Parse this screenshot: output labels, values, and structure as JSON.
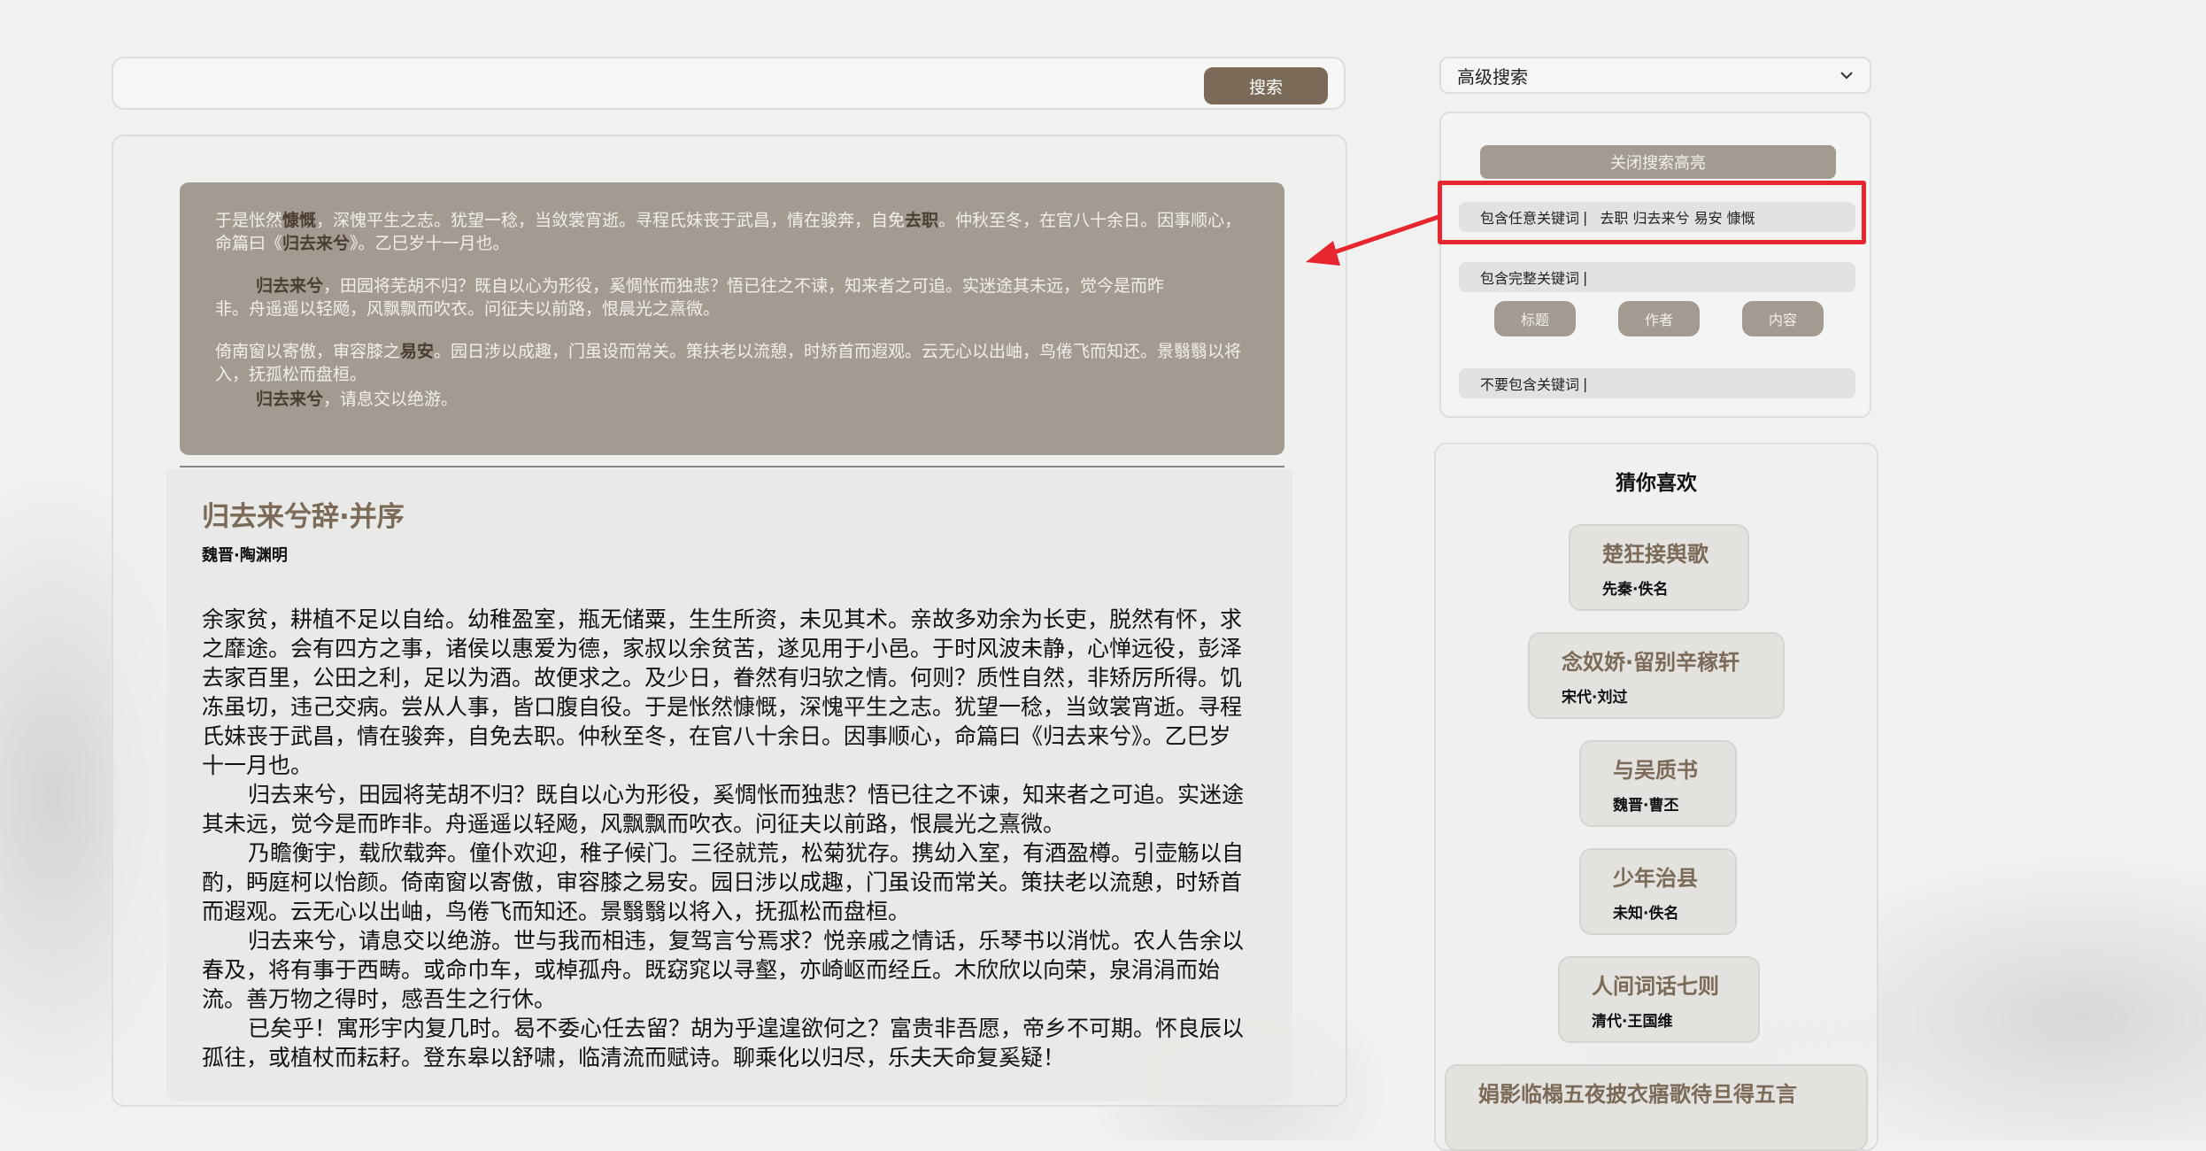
{
  "search": {
    "value": "",
    "button_label": "搜索"
  },
  "highlight": {
    "p1": {
      "a": "于是怅然",
      "k1": "慷慨",
      "b": "，深愧平生之志。犹望一稔，当敛裳宵逝。寻程氏妹丧于武昌，情在骏奔，自免",
      "k2": "去职",
      "c": "。仲秋至冬，在官八十余日。因事顺心，命篇曰《",
      "k3": "归去来兮",
      "d": "》。乙巳岁十一月也。"
    },
    "p2": {
      "k1": "归去来兮",
      "a": "，田园将芜胡不归？既自以心为形役，奚惆怅而独悲？悟已往之不谏，知来者之可追。实迷途其未远，觉今是而昨非。舟遥遥以轻飏，风飘飘而吹衣。问征夫以前路，恨晨光之熹微。"
    },
    "p3": {
      "a": "倚南窗以寄傲，审容膝之",
      "k1": "易安",
      "b": "。园日涉以成趣，门虽设而常关。策扶老以流憩，时矫首而遐观。云无心以出岫，鸟倦飞而知还。景翳翳以将入，抚孤松而盘桓。"
    },
    "p4": {
      "k1": "归去来兮",
      "a": "，请息交以绝游。"
    }
  },
  "poem": {
    "title": "归去来兮辞·并序",
    "author": "魏晋·陶渊明",
    "paragraphs": [
      "余家贫，耕植不足以自给。幼稚盈室，瓶无储粟，生生所资，未见其术。亲故多劝余为长吏，脱然有怀，求之靡途。会有四方之事，诸侯以惠爱为德，家叔以余贫苦，遂见用于小邑。于时风波未静，心惮远役，彭泽去家百里，公田之利，足以为酒。故便求之。及少日，眷然有归欤之情。何则？质性自然，非矫厉所得。饥冻虽切，违己交病。尝从人事，皆口腹自役。于是怅然慷慨，深愧平生之志。犹望一稔，当敛裳宵逝。寻程氏妹丧于武昌，情在骏奔，自免去职。仲秋至冬，在官八十余日。因事顺心，命篇曰《归去来兮》。乙巳岁十一月也。",
      "归去来兮，田园将芜胡不归？既自以心为形役，奚惆怅而独悲？悟已往之不谏，知来者之可追。实迷途其未远，觉今是而昨非。舟遥遥以轻飏，风飘飘而吹衣。问征夫以前路，恨晨光之熹微。",
      "乃瞻衡宇，载欣载奔。僮仆欢迎，稚子候门。三径就荒，松菊犹存。携幼入室，有酒盈樽。引壶觞以自酌，眄庭柯以怡颜。倚南窗以寄傲，审容膝之易安。园日涉以成趣，门虽设而常关。策扶老以流憩，时矫首而遐观。云无心以出岫，鸟倦飞而知还。景翳翳以将入，抚孤松而盘桓。",
      "归去来兮，请息交以绝游。世与我而相违，复驾言兮焉求？悦亲戚之情话，乐琴书以消忧。农人告余以春及，将有事于西畴。或命巾车，或棹孤舟。既窈窕以寻壑，亦崎岖而经丘。木欣欣以向荣，泉涓涓而始流。善万物之得时，感吾生之行休。",
      "已矣乎！寓形宇内复几时。曷不委心任去留？胡为乎遑遑欲何之？富贵非吾愿，帝乡不可期。怀良辰以孤往，或植杖而耘耔。登东皋以舒啸，临清流而赋诗。聊乘化以归尽，乐夫天命复奚疑！"
    ]
  },
  "advanced": {
    "label": "高级搜索",
    "close_highlight": "关闭搜索高亮",
    "any_label": "包含任意关键词",
    "any_value": "去职 归去来兮 易安 慷慨",
    "exact_label": "包含完整关键词",
    "exact_value": "",
    "scopes": [
      "标题",
      "作者",
      "内容"
    ],
    "not_label": "不要包含关键词",
    "not_value": ""
  },
  "recommend": {
    "heading": "猜你喜欢",
    "items": [
      {
        "title": "楚狂接舆歌",
        "author": "先秦·佚名"
      },
      {
        "title": "念奴娇·留别辛稼轩",
        "author": "宋代·刘过"
      },
      {
        "title": "与吴质书",
        "author": "魏晋·曹丕"
      },
      {
        "title": "少年治县",
        "author": "未知·佚名"
      },
      {
        "title": "人间词话七则",
        "author": "清代·王国维"
      },
      {
        "title": "娟影临榻五夜披衣寤歌待旦得五言",
        "author": ""
      }
    ]
  },
  "colors": {
    "accent": "#7a6a57",
    "highlight_bg": "#a39b92",
    "annotation": "#e8262f"
  }
}
